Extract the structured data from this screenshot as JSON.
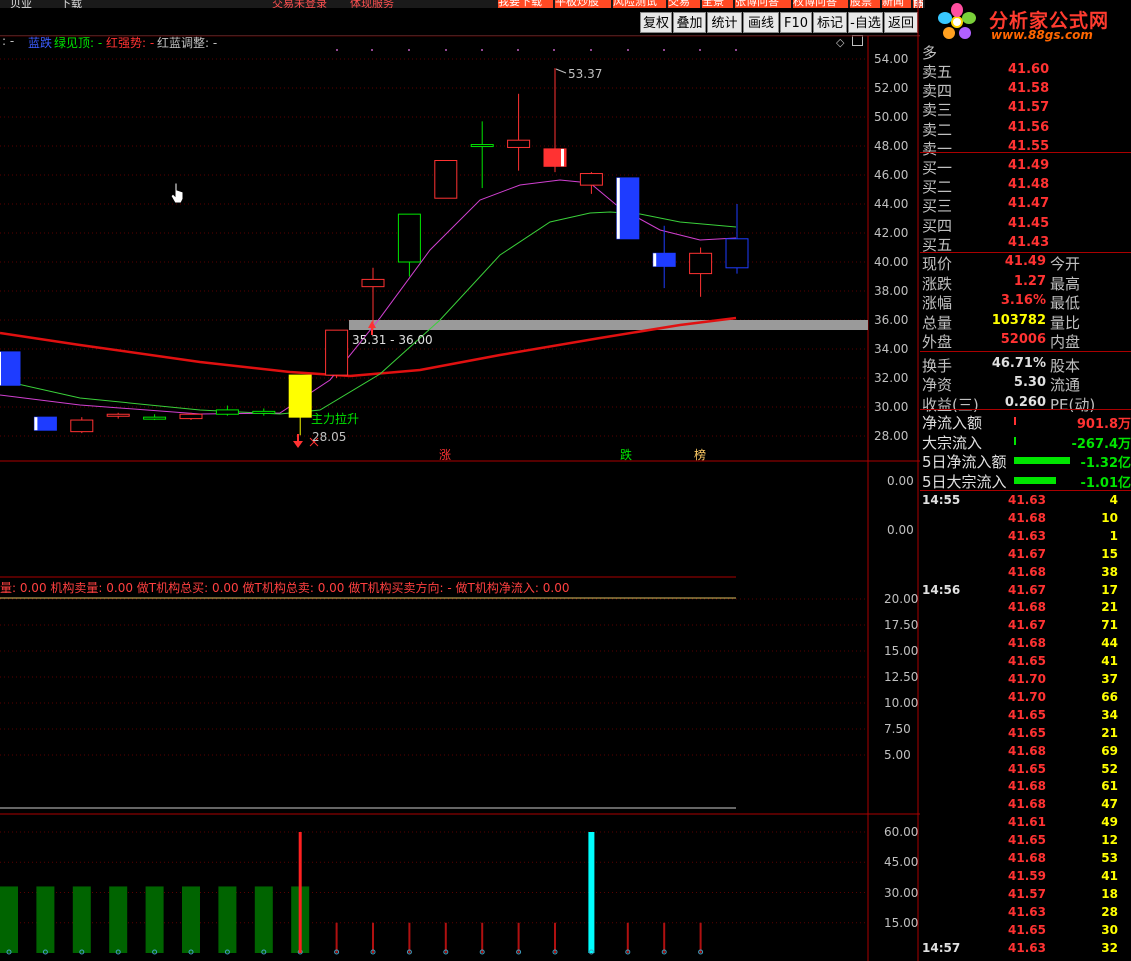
{
  "topbar": {
    "left1": "贝业",
    "left2": "下载",
    "notice1": "交易未登录",
    "notice2": "体现服务",
    "right_items": [
      "我要下载",
      "平板炒股",
      "风险测试",
      "交易",
      "全景",
      "张博问答",
      "权博问答",
      "股票",
      "新闻",
      "帮助"
    ]
  },
  "toolbar": {
    "buttons": [
      "复权",
      "叠加",
      "统计",
      "画线",
      "F10",
      "标记",
      "-自选",
      "返回"
    ]
  },
  "logo": {
    "title": "分析家公式网",
    "url": "www.88gs.com"
  },
  "legend": {
    "items": [
      {
        "text": ": -",
        "color": "#c0c0c0"
      },
      {
        "text": "蓝跌",
        "color": "#3c5cff"
      },
      {
        "text": "绿见顶: -",
        "color": "#00e600"
      },
      {
        "text": "红强势: -",
        "color": "#ff3232"
      },
      {
        "text": "红蓝调整: -",
        "color": "#c0c0c0"
      }
    ]
  },
  "main_chart": {
    "y_ticks": [
      "54.00",
      "52.00",
      "50.00",
      "48.00",
      "46.00",
      "44.00",
      "42.00",
      "40.00",
      "38.00",
      "36.00",
      "34.00",
      "32.00",
      "30.00",
      "28.00"
    ],
    "high_label": "53.37",
    "low_label": "28.05",
    "zone_label": "35.31 - 36.00",
    "signal_label": "主力拉升",
    "markers": [
      {
        "text": "涨",
        "color": "#ff3232"
      },
      {
        "text": "跌",
        "color": "#00e600"
      },
      {
        "text": "榜",
        "color": "#ffcc66"
      }
    ],
    "candles": [
      {
        "o": 31.5,
        "c": 33.8,
        "h": 33.8,
        "l": 31.5,
        "color": "blue"
      },
      {
        "o": 29.3,
        "c": 28.4,
        "h": 29.3,
        "l": 28.4,
        "color": "blue"
      },
      {
        "o": 28.3,
        "c": 29.1,
        "h": 29.3,
        "l": 28.2,
        "color": "red"
      },
      {
        "o": 29.4,
        "c": 29.5,
        "h": 29.6,
        "l": 29.2,
        "color": "red"
      },
      {
        "o": 29.3,
        "c": 29.2,
        "h": 29.5,
        "l": 29.1,
        "color": "green"
      },
      {
        "o": 29.2,
        "c": 29.5,
        "h": 29.6,
        "l": 29.1,
        "color": "red"
      },
      {
        "o": 29.5,
        "c": 29.8,
        "h": 30.1,
        "l": 29.4,
        "color": "green"
      },
      {
        "o": 29.6,
        "c": 29.7,
        "h": 29.9,
        "l": 29.4,
        "color": "green"
      },
      {
        "o": 29.3,
        "c": 32.2,
        "h": 32.2,
        "l": 28.05,
        "color": "yellow"
      },
      {
        "o": 32.2,
        "c": 35.3,
        "h": 35.3,
        "l": 32.0,
        "color": "red"
      },
      {
        "o": 38.3,
        "c": 38.8,
        "h": 39.6,
        "l": 35.3,
        "color": "red"
      },
      {
        "o": 40.0,
        "c": 43.3,
        "h": 43.3,
        "l": 39.0,
        "color": "green"
      },
      {
        "o": 44.4,
        "c": 47.0,
        "h": 47.0,
        "l": 44.4,
        "color": "red"
      },
      {
        "o": 48.1,
        "c": 48.1,
        "h": 49.7,
        "l": 45.1,
        "color": "green"
      },
      {
        "o": 47.9,
        "c": 48.4,
        "h": 51.6,
        "l": 46.3,
        "color": "red"
      },
      {
        "o": 46.6,
        "c": 47.8,
        "h": 53.37,
        "l": 46.2,
        "color": "redfill"
      },
      {
        "o": 45.3,
        "c": 46.1,
        "h": 46.2,
        "l": 44.7,
        "color": "red"
      },
      {
        "o": 45.8,
        "c": 41.6,
        "h": 45.8,
        "l": 41.6,
        "color": "blue"
      },
      {
        "o": 40.6,
        "c": 39.7,
        "h": 42.5,
        "l": 38.2,
        "color": "blue"
      },
      {
        "o": 39.2,
        "c": 40.6,
        "h": 41.0,
        "l": 37.6,
        "color": "red"
      },
      {
        "o": 39.6,
        "c": 41.6,
        "h": 44.0,
        "l": 39.2,
        "color": "blue-outline"
      }
    ]
  },
  "sub1": {
    "y_ticks": [
      "0.00",
      "0.00"
    ]
  },
  "sub2": {
    "label": "量: 0.00  机构卖量: 0.00  做T机构总买: 0.00  做T机构总卖: 0.00  做T机构买卖方向: -  做T机构净流入: 0.00",
    "y_ticks": [
      "20.00",
      "17.50",
      "15.00",
      "12.50",
      "10.00",
      "7.50",
      "5.00"
    ]
  },
  "sub3": {
    "y_ticks": [
      "60.00",
      "45.00",
      "30.00",
      "15.00"
    ],
    "bars": [
      33,
      33,
      33,
      33,
      33,
      33,
      33,
      33,
      33,
      15,
      15,
      15,
      15,
      15,
      15,
      15,
      15,
      15,
      15,
      15
    ],
    "bar_types": [
      "g",
      "g",
      "g",
      "g",
      "g",
      "g",
      "g",
      "g",
      "g",
      "r",
      "r",
      "r",
      "r",
      "r",
      "r",
      "r",
      "c",
      "r",
      "r",
      "r"
    ],
    "spikes": [
      {
        "index": 8,
        "value": 60,
        "color": "red"
      },
      {
        "index": 16,
        "value": 60,
        "color": "cyan"
      }
    ]
  },
  "quote": {
    "order_book": [
      {
        "label": "卖五",
        "price": "41.60"
      },
      {
        "label": "卖四",
        "price": "41.58"
      },
      {
        "label": "卖三",
        "price": "41.57"
      },
      {
        "label": "卖二",
        "price": "41.56"
      },
      {
        "label": "卖一",
        "price": "41.55"
      },
      {
        "label": "买一",
        "price": "41.49"
      },
      {
        "label": "买二",
        "price": "41.48"
      },
      {
        "label": "买三",
        "price": "41.47"
      },
      {
        "label": "买四",
        "price": "41.45"
      },
      {
        "label": "买五",
        "price": "41.43"
      }
    ],
    "stats": [
      {
        "label": "现价",
        "value": "41.49",
        "color": "red",
        "label2": "今开"
      },
      {
        "label": "涨跌",
        "value": "1.27",
        "color": "red",
        "label2": "最高"
      },
      {
        "label": "涨幅",
        "value": "3.16%",
        "color": "red",
        "label2": "最低"
      },
      {
        "label": "总量",
        "value": "103782",
        "color": "yellow",
        "label2": "量比"
      },
      {
        "label": "外盘",
        "value": "52006",
        "color": "red",
        "label2": "内盘"
      },
      {
        "label": "换手",
        "value": "46.71%",
        "color": "white",
        "label2": "股本"
      },
      {
        "label": "净资",
        "value": "5.30",
        "color": "white",
        "label2": "流通"
      },
      {
        "label": "收益(三)",
        "value": "0.260",
        "color": "white",
        "label2": "PE(动)"
      }
    ],
    "flows": [
      {
        "label": "净流入额",
        "value": "901.8万",
        "color": "red",
        "bar": 0
      },
      {
        "label": "大宗流入",
        "value": "-267.4万",
        "color": "green",
        "bar": 0
      },
      {
        "label": "5日净流入额",
        "value": "-1.32亿",
        "color": "green",
        "bar": 56
      },
      {
        "label": "5日大宗流入",
        "value": "-1.01亿",
        "color": "green",
        "bar": 42
      }
    ],
    "ticks": [
      {
        "time": "14:55",
        "price": "41.63",
        "vol": "4"
      },
      {
        "time": "",
        "price": "41.68",
        "vol": "10"
      },
      {
        "time": "",
        "price": "41.63",
        "vol": "1"
      },
      {
        "time": "",
        "price": "41.67",
        "vol": "15"
      },
      {
        "time": "",
        "price": "41.68",
        "vol": "38"
      },
      {
        "time": "14:56",
        "price": "41.67",
        "vol": "17"
      },
      {
        "time": "",
        "price": "41.68",
        "vol": "21"
      },
      {
        "time": "",
        "price": "41.67",
        "vol": "71"
      },
      {
        "time": "",
        "price": "41.68",
        "vol": "44"
      },
      {
        "time": "",
        "price": "41.65",
        "vol": "41"
      },
      {
        "time": "",
        "price": "41.70",
        "vol": "37"
      },
      {
        "time": "",
        "price": "41.70",
        "vol": "66"
      },
      {
        "time": "",
        "price": "41.65",
        "vol": "34"
      },
      {
        "time": "",
        "price": "41.65",
        "vol": "21"
      },
      {
        "time": "",
        "price": "41.68",
        "vol": "69"
      },
      {
        "time": "",
        "price": "41.65",
        "vol": "52"
      },
      {
        "time": "",
        "price": "41.68",
        "vol": "61"
      },
      {
        "time": "",
        "price": "41.68",
        "vol": "47"
      },
      {
        "time": "",
        "price": "41.61",
        "vol": "49"
      },
      {
        "time": "",
        "price": "41.65",
        "vol": "12"
      },
      {
        "time": "",
        "price": "41.68",
        "vol": "53"
      },
      {
        "time": "",
        "price": "41.59",
        "vol": "41"
      },
      {
        "time": "",
        "price": "41.57",
        "vol": "18"
      },
      {
        "time": "",
        "price": "41.63",
        "vol": "28"
      },
      {
        "time": "",
        "price": "41.65",
        "vol": "30"
      },
      {
        "time": "14:57",
        "price": "41.63",
        "vol": "32"
      }
    ]
  },
  "colors": {
    "up": "#ff3232",
    "down": "#00e600",
    "blue": "#1e3cff",
    "yellow": "#ffff00",
    "cyan": "#00ffff",
    "ma_long": "#e01010",
    "ma_mid": "#3ad03a",
    "ma_short": "#d040d0"
  }
}
